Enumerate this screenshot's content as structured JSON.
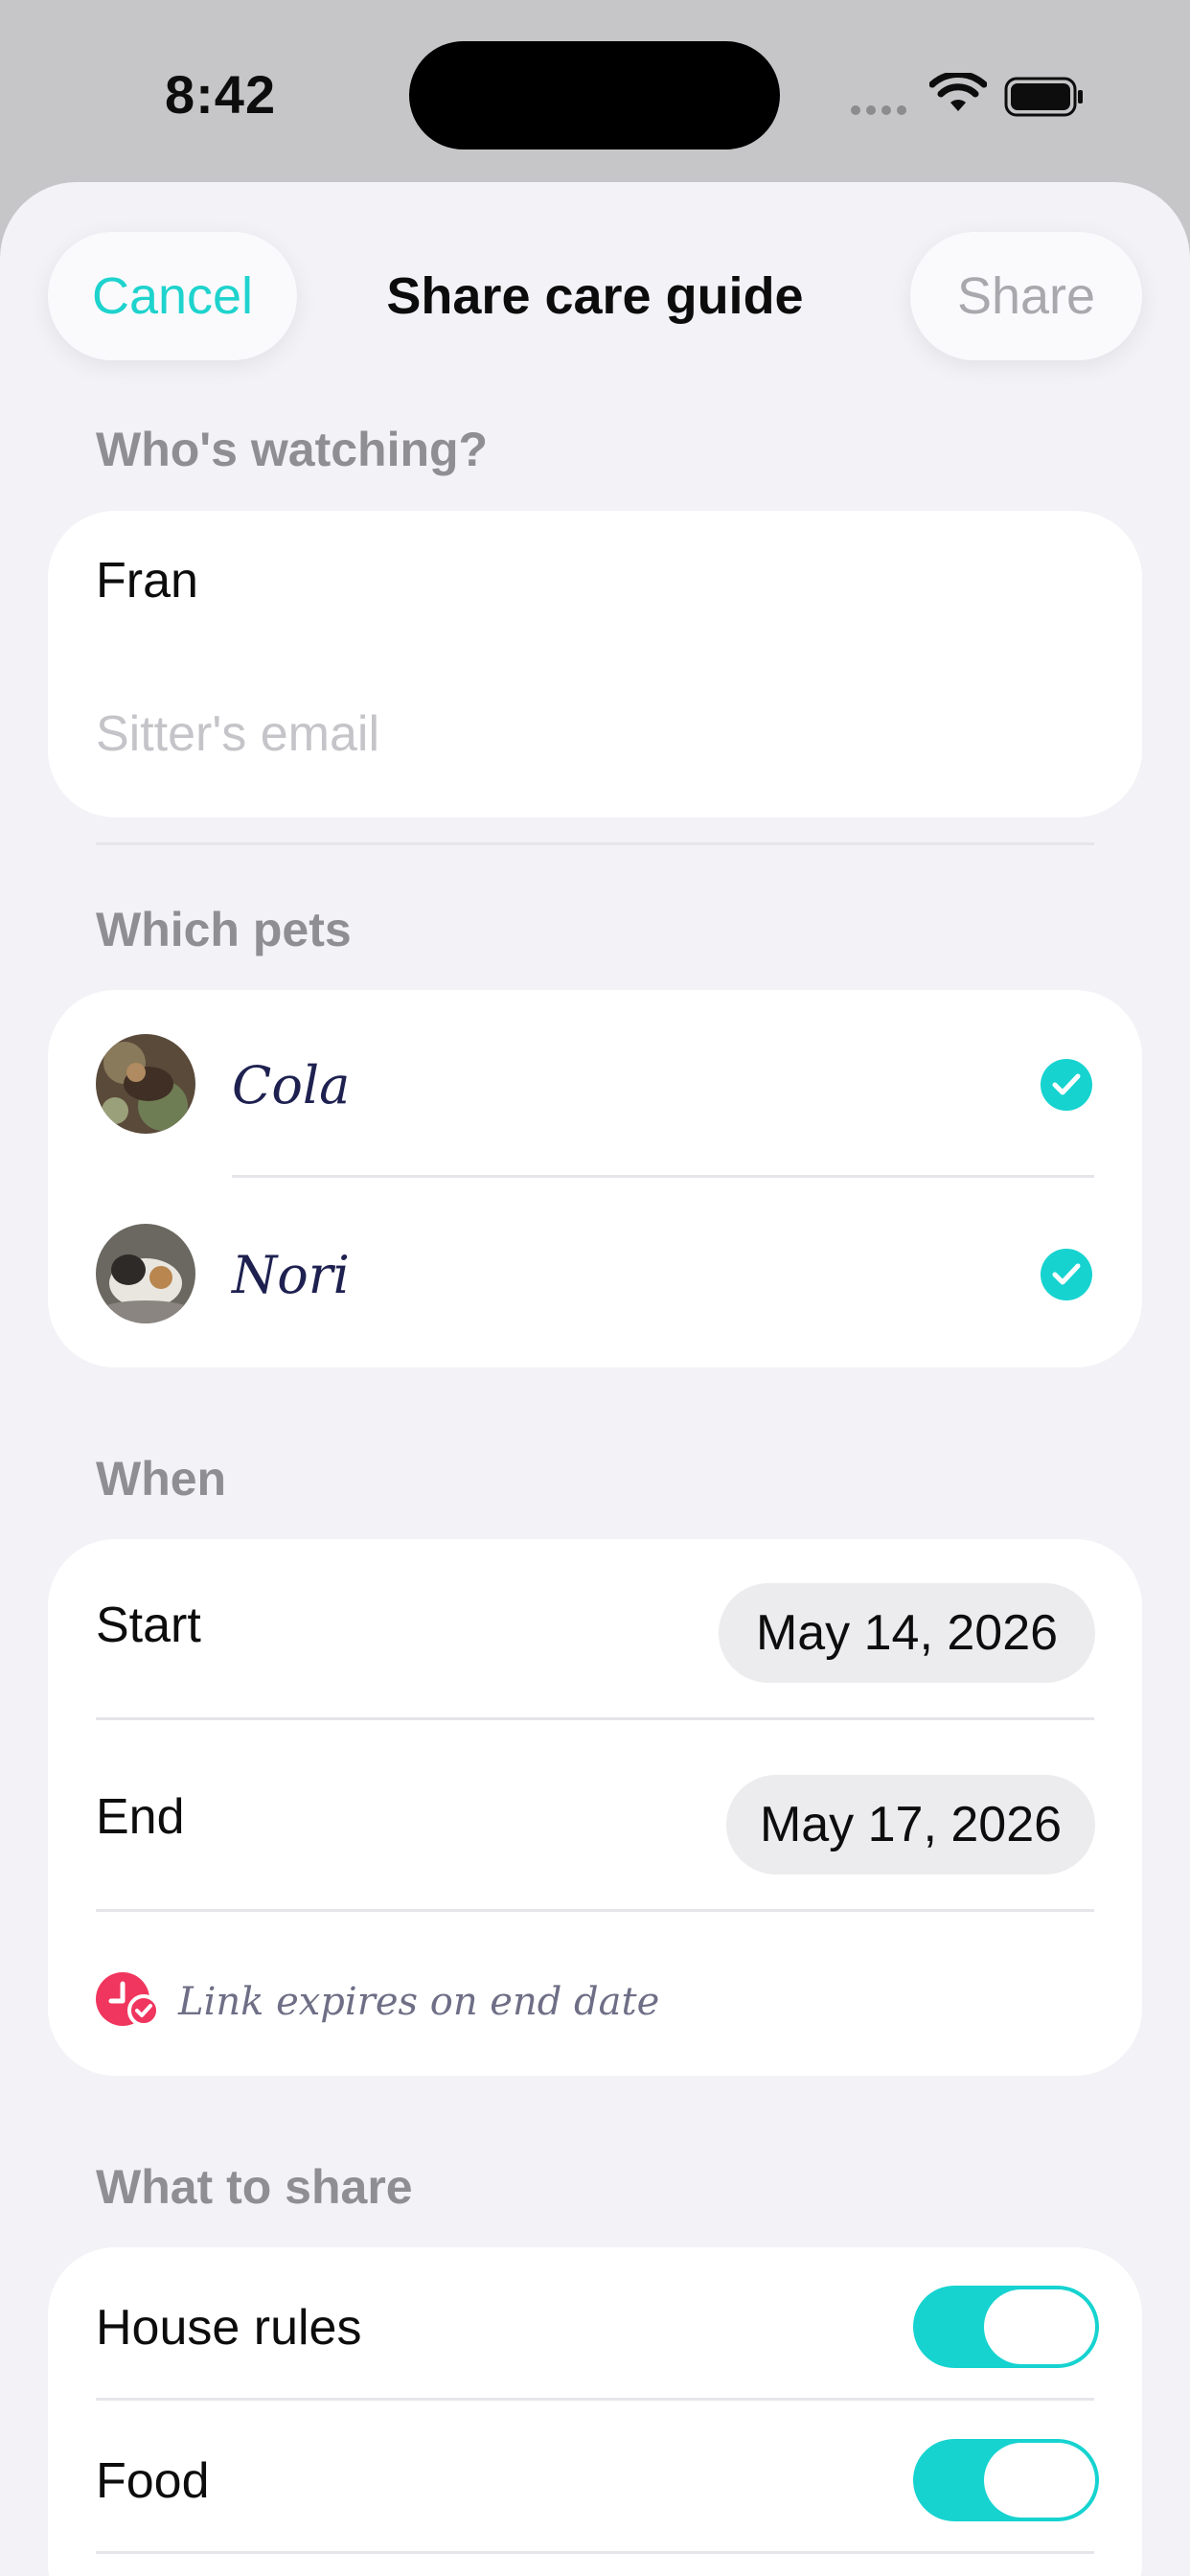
{
  "status_bar": {
    "time": "8:42"
  },
  "nav": {
    "cancel_label": "Cancel",
    "title": "Share care guide",
    "share_label": "Share"
  },
  "watching": {
    "section_label": "Who's watching?",
    "name_value": "Fran",
    "email_placeholder": "Sitter's email"
  },
  "pets": {
    "section_label": "Which pets",
    "items": [
      {
        "name": "Cola",
        "selected": true
      },
      {
        "name": "Nori",
        "selected": true
      }
    ]
  },
  "when": {
    "section_label": "When",
    "start_label": "Start",
    "start_value": "May 14, 2026",
    "end_label": "End",
    "end_value": "May 17, 2026",
    "expire_note": "Link expires on end date"
  },
  "share_items": {
    "section_label": "What to share",
    "items": [
      {
        "label": "House rules",
        "enabled": true
      },
      {
        "label": "Food",
        "enabled": true
      }
    ]
  },
  "colors": {
    "accent": "#1ed3cd",
    "expire_icon": "#f0365e",
    "section_label": "#8e8e93",
    "background": "#f2f2f7"
  },
  "icons": {
    "check": "checkmark-circle-icon",
    "expire": "clock-check-icon"
  }
}
